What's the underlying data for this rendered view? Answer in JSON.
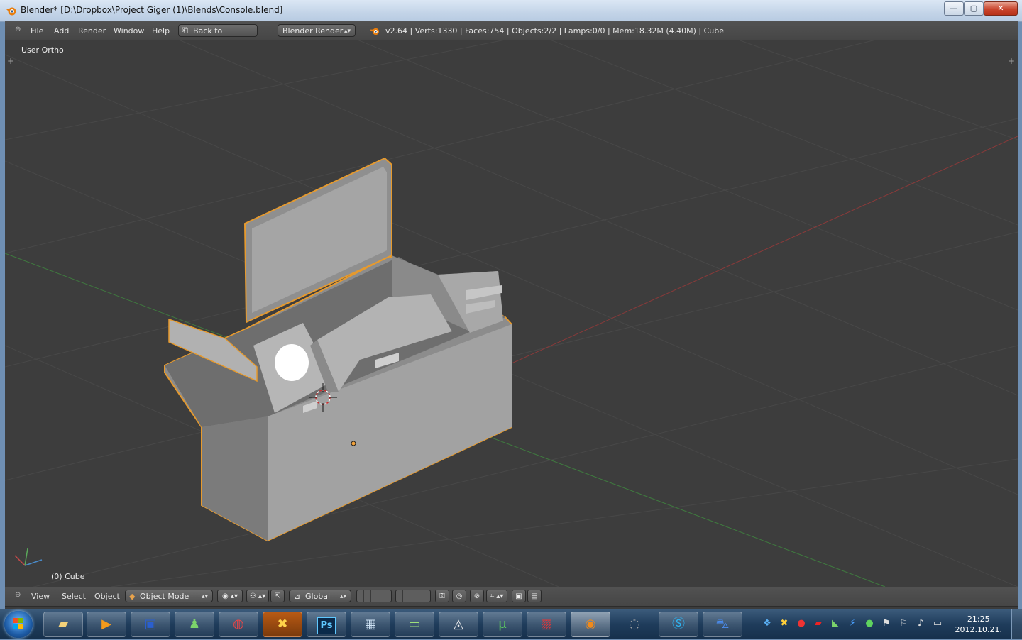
{
  "window": {
    "title": "Blender* [D:\\Dropbox\\Project Giger (1)\\Blends\\Console.blend]",
    "minimize": "—",
    "maximize": "▢",
    "close": "✕"
  },
  "info_header": {
    "menus": [
      "File",
      "Add",
      "Render",
      "Window",
      "Help"
    ],
    "back_button": "Back to Previous",
    "render_engine": "Blender Render",
    "stats": "v2.64 | Verts:1330 | Faces:754 | Objects:2/2 | Lamps:0/0 | Mem:18.32M (4.40M) | Cube"
  },
  "viewport": {
    "view_label": "User Ortho",
    "object_label": "(0) Cube"
  },
  "view3d_header": {
    "menus": [
      "View",
      "Select",
      "Object"
    ],
    "mode": "Object Mode",
    "orientation": "Global"
  },
  "taskbar": {
    "apps": [
      "explorer-icon",
      "media-icon",
      "save-icon",
      "messenger-icon",
      "chrome-icon",
      "cheat-icon",
      "photoshop-icon",
      "calculator-icon",
      "monitor-icon",
      "unity-icon",
      "utorrent-icon",
      "stripes-icon",
      "blender-icon",
      "loading-icon",
      "skype-icon",
      "car-icon"
    ],
    "photoshop_label": "Ps",
    "time": "21:25",
    "date": "2012.10.21."
  },
  "colors": {
    "selection_outline": "#e69a2e",
    "viewport_bg": "#3d3d3d",
    "grid_line": "#4a4a4a",
    "x_axis": "#8a3a3a",
    "y_axis": "#3f7a3f"
  }
}
